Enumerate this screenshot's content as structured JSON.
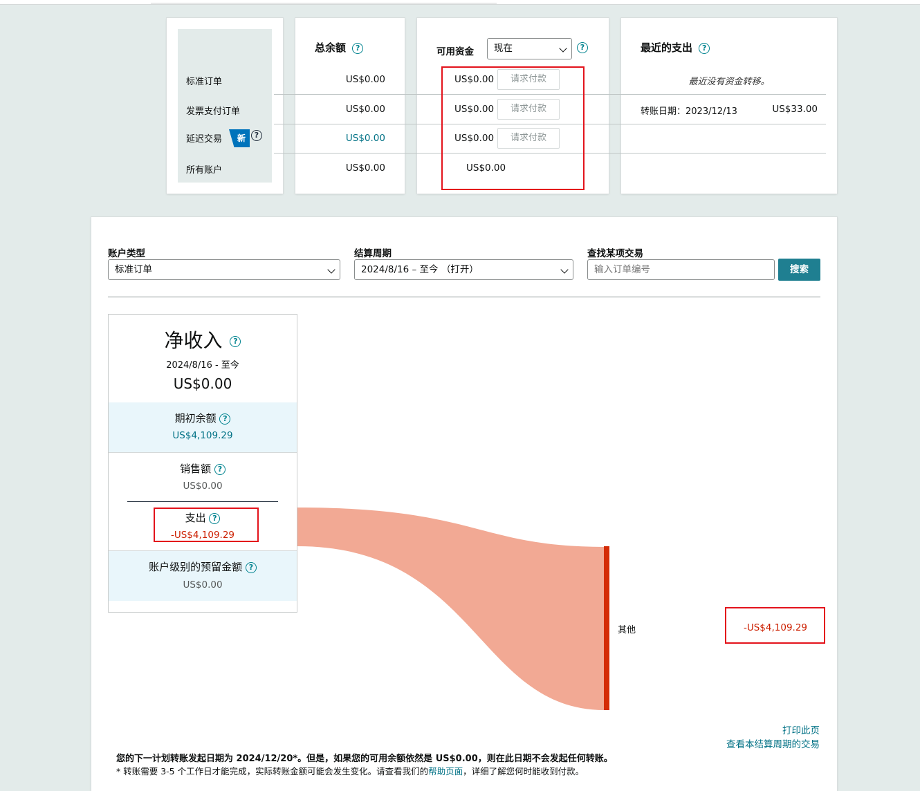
{
  "summary": {
    "row_labels": [
      "标准订单",
      "发票支付订单",
      "延迟交易",
      "所有账户"
    ],
    "new_badge": "新",
    "total_balance": {
      "title": "总余额",
      "values": [
        "US$0.00",
        "US$0.00",
        "US$0.00",
        "US$0.00"
      ]
    },
    "available_funds": {
      "title": "可用资金",
      "select_value": "现在",
      "values": [
        "US$0.00",
        "US$0.00",
        "US$0.00",
        "US$0.00"
      ],
      "request_button": "请求付款"
    },
    "recent_payouts": {
      "title": "最近的支出",
      "empty_message": "最近没有资金转移。",
      "transfer_label": "转账日期：2023/12/13",
      "transfer_amount": "US$33.00"
    }
  },
  "filters": {
    "account_type": {
      "label": "账户类型",
      "value": "标准订单"
    },
    "settlement_period": {
      "label": "结算周期",
      "value": "2024/8/16 – 至今 （打开）"
    },
    "search": {
      "label": "查找某项交易",
      "placeholder": "输入订单编号",
      "button": "搜索"
    }
  },
  "net_income": {
    "title": "净收入",
    "period": "2024/8/16 - 至今",
    "amount": "US$0.00",
    "opening_balance": {
      "label": "期初余额",
      "value": "US$4,109.29"
    },
    "sales": {
      "label": "销售额",
      "value": "US$0.00"
    },
    "expenses": {
      "label": "支出",
      "value": "-US$4,109.29"
    },
    "reserve": {
      "label": "账户级别的预留金额",
      "value": "US$0.00"
    }
  },
  "flow": {
    "category": "其他",
    "amount": "-US$4,109.29",
    "colors": {
      "band": "#f2a994",
      "bar": "#d42b06",
      "negative": "#cc1f00"
    }
  },
  "footer": {
    "print_link": "打印此页",
    "view_link": "查看本结算周期的交易",
    "notice": "您的下一计划转账发起日期为 2024/12/20*。但是，如果您的可用余额依然是 US$0.00，则在此日期不会发起任何转账。",
    "note_prefix": "* 转账需要 3-5 个工作日才能完成，实际转账金额可能会发生变化。请查看我们的",
    "note_link": "帮助页面",
    "note_suffix": "，详细了解您何时能收到付款。"
  }
}
